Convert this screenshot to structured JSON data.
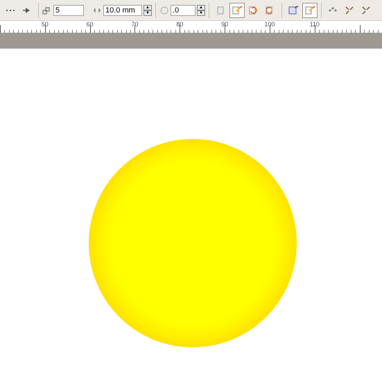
{
  "toolbar": {
    "steps_value": "5",
    "offset_value": "10.0 mm",
    "secondary_value": ".0"
  },
  "ruler": {
    "start": 40,
    "end": 125,
    "labels": [
      50,
      60,
      70,
      80,
      90,
      100,
      110
    ]
  },
  "canvas": {
    "circle": {
      "fill_inner": "#ffff00",
      "fill_outer": "#ff9e00"
    }
  }
}
